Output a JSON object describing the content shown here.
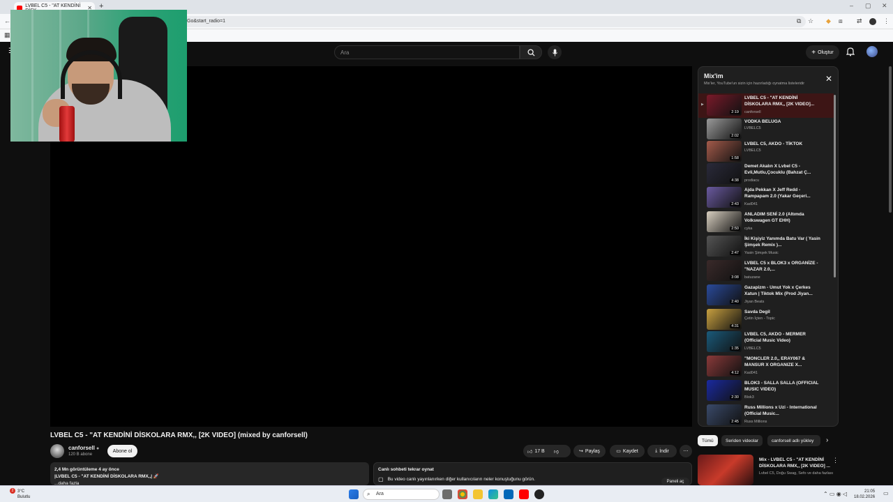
{
  "browser": {
    "tab_title": "LVBEL C5 - \"AT KENDİNİ DİSK",
    "new_tab": "+",
    "url_fragment": "Go&start_radio=1",
    "window_controls": [
      "–",
      "▢",
      "✕"
    ]
  },
  "youtube": {
    "search_placeholder": "Ara",
    "create_label": "Oluştur"
  },
  "video": {
    "title": "LVBEL C5 - \"AT KENDİNİ DİSKOLARA RMX,, [2K VIDEO] (mixed by canforsell)",
    "channel": "canforsell",
    "subscribers": "120 B abone",
    "subscribe": "Abone ol",
    "likes": "17 B",
    "share": "Paylaş",
    "save": "Kaydet",
    "download": "İndir",
    "more": "⋯",
    "views_date": "2,4 Mn görüntüleme  4 ay önce",
    "desc_line": "|LVBEL C5 - \"AT KENDİNİ DİSKOLARA RMX,,| 🚀",
    "desc_more": "...daha fazla",
    "chat_title": "Canlı sohbeti tekrar oynat",
    "chat_desc": "Bu video canlı yayınlanırken diğer kullanıcıların neler konuştuğunu görün.",
    "chat_open": "Paneli aç"
  },
  "mix": {
    "title": "Mix'im",
    "subtitle": "Mix'ler, YouTube'un sizin için hazırladığı oynatma listeleridir",
    "items": [
      {
        "title": "LVBEL C5 - \"AT KENDİNİ DİSKOLARA RMX,, [2K VIDEO]...",
        "channel": "canforsell",
        "duration": "2:19",
        "color": "#7a1a2a"
      },
      {
        "title": "VODKA BELUGA",
        "channel": "LVBELC5",
        "duration": "2:02",
        "color": "#9a9a9a"
      },
      {
        "title": "LVBEL C5, AKDO - TİKTOK",
        "channel": "LVBELC5",
        "duration": "1:58",
        "color": "#a35a4a"
      },
      {
        "title": "Demet Akalın X Lvbel C5 - Evli,Mutlu,Çocuklu (Bahzat Ç...",
        "channel": "prodiacu",
        "duration": "4:38",
        "color": "#2a2a3a"
      },
      {
        "title": "Ajda Pekkan X Jeff Redd - Rampapam 2.0 (Yakar Geçeri...",
        "channel": "Kad041",
        "duration": "2:43",
        "color": "#6a5aa0"
      },
      {
        "title": "ANLADIM SENİ 2.0 (Altımda Volkswagen GT EHH)",
        "channel": "cyka",
        "duration": "2:50",
        "color": "#d8cfc0"
      },
      {
        "title": "İki Kişiyiz Yanımda Batu Var ( Yasin Şimşek Remix )...",
        "channel": "Yasin Şimşek Music",
        "duration": "2:47",
        "color": "#555"
      },
      {
        "title": "LVBEL C5 x BLOK3 x ORGANİZE - \"NAZAR 2.0,...",
        "channel": "batuzane",
        "duration": "3:08",
        "color": "#3a2a2a"
      },
      {
        "title": "Gazapizm - Umut Yok x Çerkes Xatun | Tiktok Mix (Prod Jiyan...",
        "channel": "Jiyan Beats",
        "duration": "2:40",
        "color": "#2a4a9a"
      },
      {
        "title": "Savda Degil",
        "channel": "Çetin İçten - Topic",
        "duration": "4:31",
        "color": "#c8a040"
      },
      {
        "title": "LVBEL C5, AKDO - MERMER (Official Music Video)",
        "channel": "LVBELC5",
        "duration": "1:35",
        "color": "#1a5a7a"
      },
      {
        "title": "\"MONCLER 2.0,, ERAY067 & MANSUR X ORGANIZE X...",
        "channel": "Kad041",
        "duration": "4:12",
        "color": "#8a3a3a"
      },
      {
        "title": "BLOK3 - SALLA SALLA (OFFICIAL MUSIC VIDEO)",
        "channel": "Blok3",
        "duration": "2:30",
        "color": "#1a2aa0"
      },
      {
        "title": "Russ Millions x Uzi - International (Official Music...",
        "channel": "Russ Millions",
        "duration": "2:45",
        "color": "#3a4a6a"
      }
    ]
  },
  "chips": [
    "Tümü",
    "Seriden videolar",
    "canforsell adlı yükley"
  ],
  "recommendation": {
    "title": "Mix - LVBEL C5 - \"AT KENDİNİ DİSKOLARA RMX,, [2K VIDEO] ...",
    "sub": "Lvbel C5, Doğu Swag, Sefo ve daha fazlası"
  },
  "taskbar": {
    "weather_temp": "3°C",
    "weather_desc": "Bulutlu",
    "search": "Ara",
    "time": "21:05",
    "date": "18.02.2026",
    "badge": "2"
  }
}
